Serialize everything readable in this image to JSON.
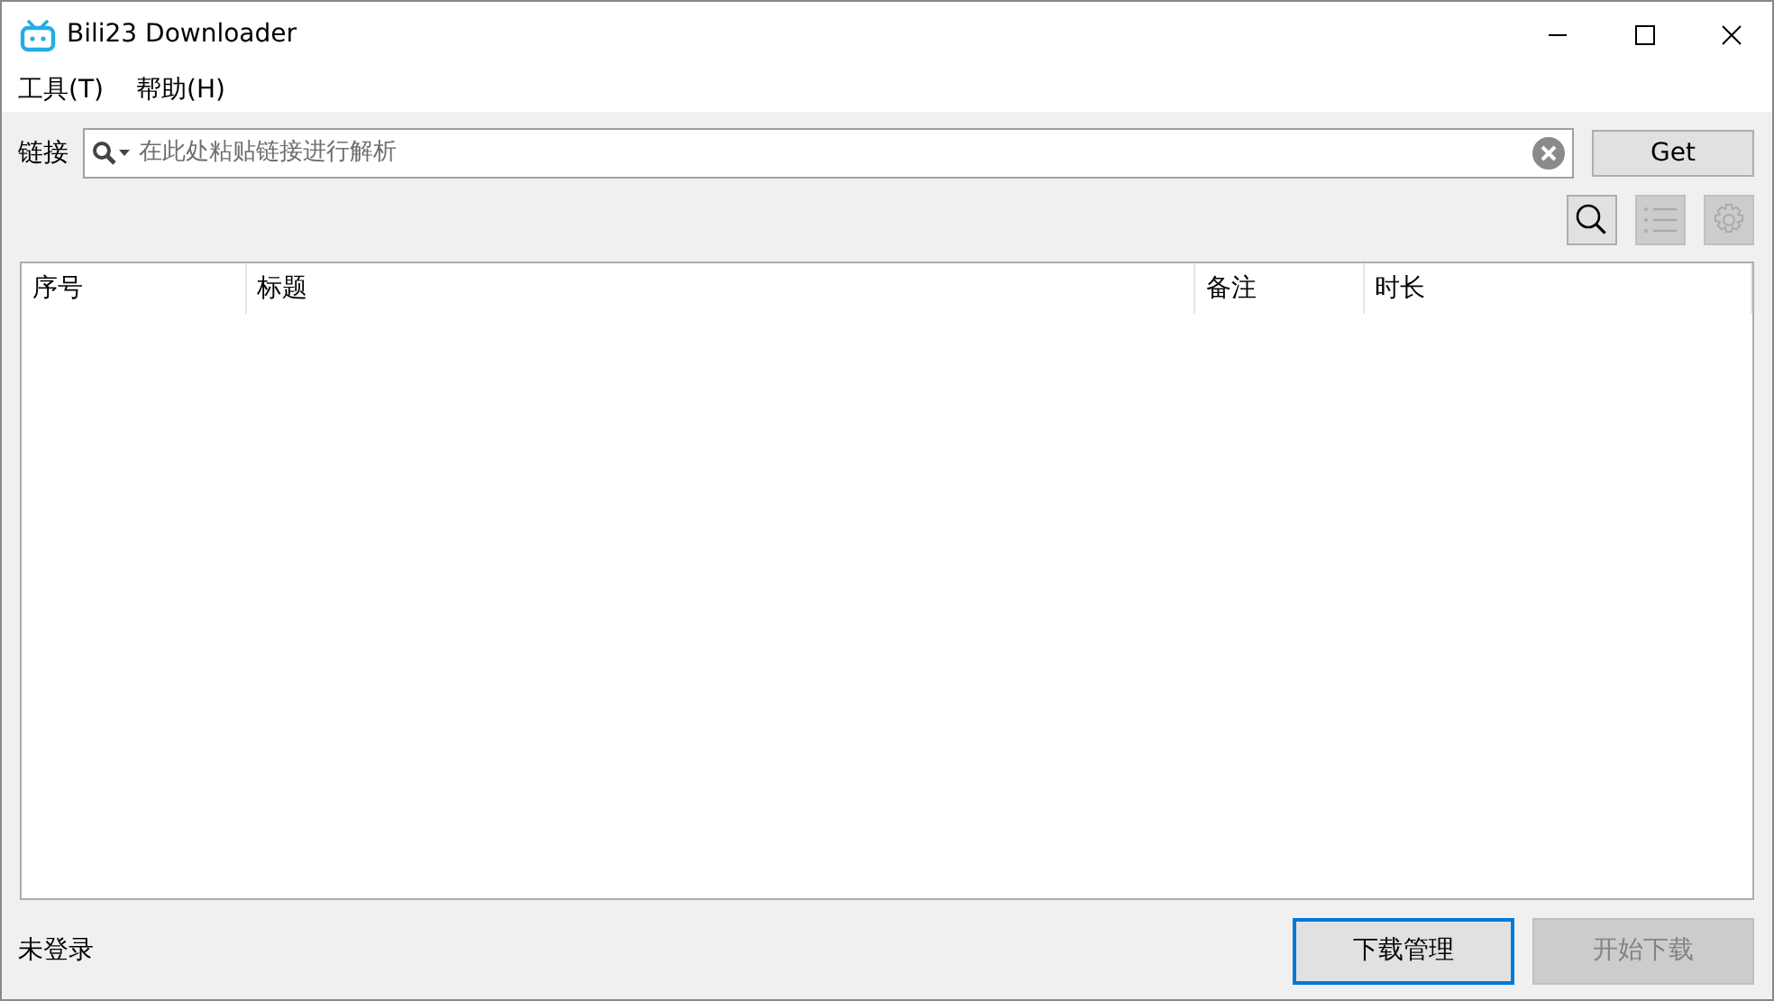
{
  "window": {
    "title": "Bili23 Downloader"
  },
  "menu": [
    {
      "label": "工具(T)"
    },
    {
      "label": "帮助(H)"
    }
  ],
  "link_bar": {
    "label": "链接",
    "placeholder": "在此处粘贴链接进行解析",
    "button": "Get"
  },
  "tools": [
    {
      "kind": "search",
      "disabled": false
    },
    {
      "kind": "list",
      "disabled": true
    },
    {
      "kind": "settings",
      "disabled": true
    }
  ],
  "table": {
    "columns": [
      "序号",
      "标题",
      "备注",
      "时长"
    ]
  },
  "status_bar": {
    "text": "未登录"
  },
  "buttons": [
    {
      "label": "下载管理",
      "focused": true,
      "disabled": false
    },
    {
      "label": "开始下载",
      "focused": false,
      "disabled": true
    }
  ]
}
